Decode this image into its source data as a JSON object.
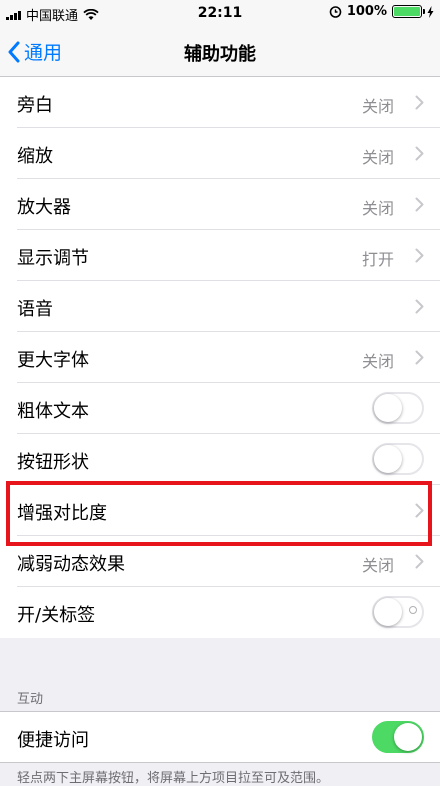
{
  "status_bar": {
    "carrier": "中国联通",
    "time": "22:11",
    "battery": "100%",
    "battery_level": 1.0
  },
  "nav": {
    "back_label": "通用",
    "title": "辅助功能"
  },
  "settings": [
    {
      "label": "旁白",
      "value": "关闭",
      "control": "chevron"
    },
    {
      "label": "缩放",
      "value": "关闭",
      "control": "chevron"
    },
    {
      "label": "放大器",
      "value": "关闭",
      "control": "chevron"
    },
    {
      "label": "显示调节",
      "value": "打开",
      "control": "chevron"
    },
    {
      "label": "语音",
      "value": "",
      "control": "chevron"
    },
    {
      "label": "更大字体",
      "value": "关闭",
      "control": "chevron"
    },
    {
      "label": "粗体文本",
      "control": "toggle",
      "on": false
    },
    {
      "label": "按钮形状",
      "control": "toggle",
      "on": false
    },
    {
      "label": "增强对比度",
      "value": "",
      "control": "chevron",
      "highlighted": true
    },
    {
      "label": "减弱动态效果",
      "value": "关闭",
      "control": "chevron"
    },
    {
      "label": "开/关标签",
      "control": "toggle",
      "on": false,
      "labels_visible": true
    }
  ],
  "interaction": {
    "header": "互动",
    "item_label": "便捷访问",
    "item_on": true,
    "footer": "轻点两下主屏幕按钮，将屏幕上方项目拉至可及范围。"
  },
  "colors": {
    "accent": "#007aff",
    "toggle_on": "#4cd964",
    "highlight_box": "#e8141b"
  }
}
